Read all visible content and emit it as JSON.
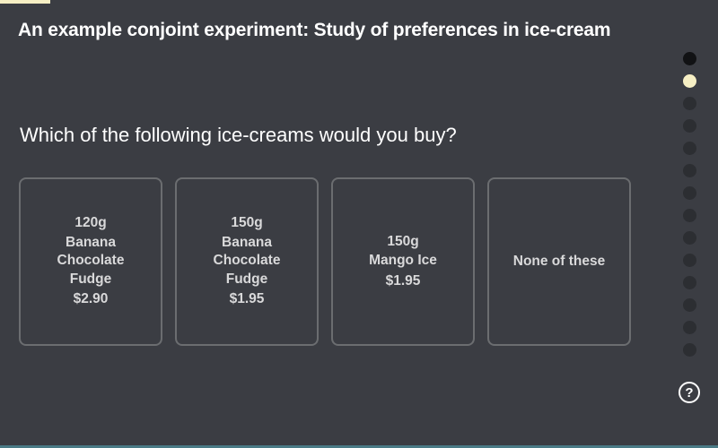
{
  "survey": {
    "title": "An example conjoint experiment: Study of preferences in ice-cream",
    "question": "Which of the following ice-creams would you buy?"
  },
  "options": [
    {
      "weight": "120g",
      "name_lines": [
        "Banana",
        "Chocolate",
        "Fudge"
      ],
      "price": "$2.90"
    },
    {
      "weight": "150g",
      "name_lines": [
        "Banana",
        "Chocolate",
        "Fudge"
      ],
      "price": "$1.95"
    },
    {
      "weight": "150g",
      "name_lines": [
        "Mango Ice"
      ],
      "price": "$1.95"
    },
    {
      "label": "None of these"
    }
  ],
  "navigation": {
    "dot_states": [
      "visited",
      "current",
      "pending",
      "pending",
      "pending",
      "pending",
      "pending",
      "pending",
      "pending",
      "pending",
      "pending",
      "pending",
      "pending",
      "pending"
    ]
  },
  "help": {
    "glyph": "?",
    "icon": "help-icon"
  },
  "colors": {
    "background": "#3b3d43",
    "accent": "#f6efc4",
    "card_border": "#6b6d70",
    "card_text": "#d9d9da",
    "bottom_line": "#4a7b86"
  }
}
